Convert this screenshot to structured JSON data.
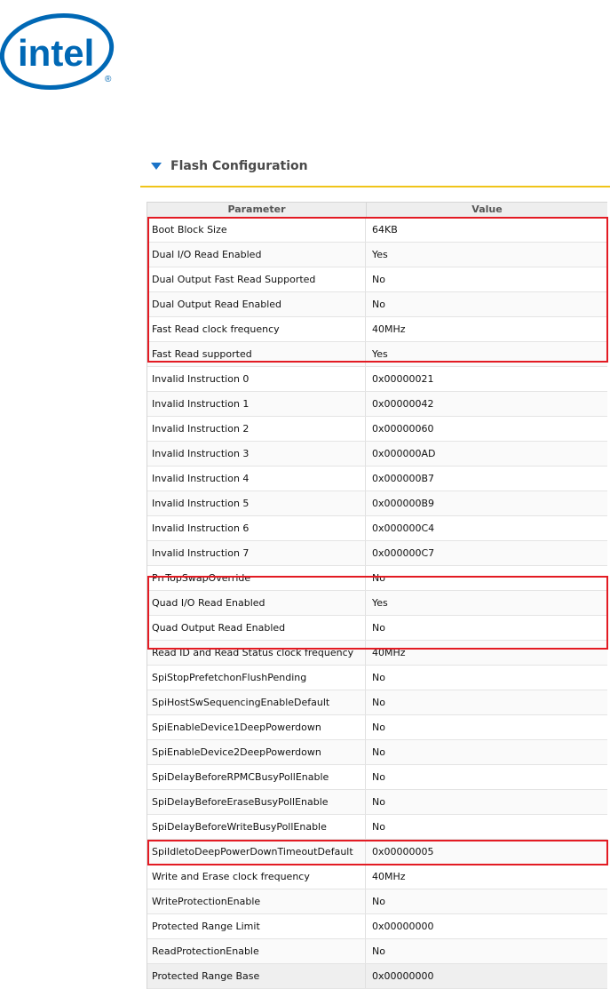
{
  "logo": {
    "text": "intel",
    "color": "#0068b5"
  },
  "section": {
    "title": "Flash Configuration",
    "icon": "triangle-down-icon",
    "accent": "#f0c419"
  },
  "table": {
    "headers": {
      "parameter": "Parameter",
      "value": "Value"
    },
    "rows": [
      {
        "parameter": "Boot Block Size",
        "value": "64KB"
      },
      {
        "parameter": "Dual I/O Read Enabled",
        "value": "Yes"
      },
      {
        "parameter": "Dual Output Fast Read Supported",
        "value": "No"
      },
      {
        "parameter": "Dual Output Read Enabled",
        "value": "No"
      },
      {
        "parameter": "Fast Read clock frequency",
        "value": "40MHz"
      },
      {
        "parameter": "Fast Read supported",
        "value": "Yes"
      },
      {
        "parameter": "Invalid Instruction 0",
        "value": "0x00000021"
      },
      {
        "parameter": "Invalid Instruction 1",
        "value": "0x00000042"
      },
      {
        "parameter": "Invalid Instruction 2",
        "value": "0x00000060"
      },
      {
        "parameter": "Invalid Instruction 3",
        "value": "0x000000AD"
      },
      {
        "parameter": "Invalid Instruction 4",
        "value": "0x000000B7"
      },
      {
        "parameter": "Invalid Instruction 5",
        "value": "0x000000B9"
      },
      {
        "parameter": "Invalid Instruction 6",
        "value": "0x000000C4"
      },
      {
        "parameter": "Invalid Instruction 7",
        "value": "0x000000C7"
      },
      {
        "parameter": "PrrTopSwapOverride",
        "value": "No"
      },
      {
        "parameter": "Quad I/O Read Enabled",
        "value": "Yes"
      },
      {
        "parameter": "Quad Output Read Enabled",
        "value": "No"
      },
      {
        "parameter": "Read ID and Read Status clock frequency",
        "value": "40MHz"
      },
      {
        "parameter": "SpiStopPrefetchonFlushPending",
        "value": "No"
      },
      {
        "parameter": "SpiHostSwSequencingEnableDefault",
        "value": "No"
      },
      {
        "parameter": "SpiEnableDevice1DeepPowerdown",
        "value": "No"
      },
      {
        "parameter": "SpiEnableDevice2DeepPowerdown",
        "value": "No"
      },
      {
        "parameter": "SpiDelayBeforeRPMCBusyPollEnable",
        "value": "No"
      },
      {
        "parameter": "SpiDelayBeforeEraseBusyPollEnable",
        "value": "No"
      },
      {
        "parameter": "SpiDelayBeforeWriteBusyPollEnable",
        "value": "No"
      },
      {
        "parameter": "SpiIdletoDeepPowerDownTimeoutDefault",
        "value": "0x00000005"
      },
      {
        "parameter": "Write and Erase clock frequency",
        "value": "40MHz"
      },
      {
        "parameter": "WriteProtectionEnable",
        "value": "No"
      },
      {
        "parameter": "Protected Range Limit",
        "value": "0x00000000"
      },
      {
        "parameter": "ReadProtectionEnable",
        "value": "No"
      },
      {
        "parameter": "Protected Range Base",
        "value": "0x00000000"
      }
    ]
  },
  "highlight_color": "#e31b23"
}
